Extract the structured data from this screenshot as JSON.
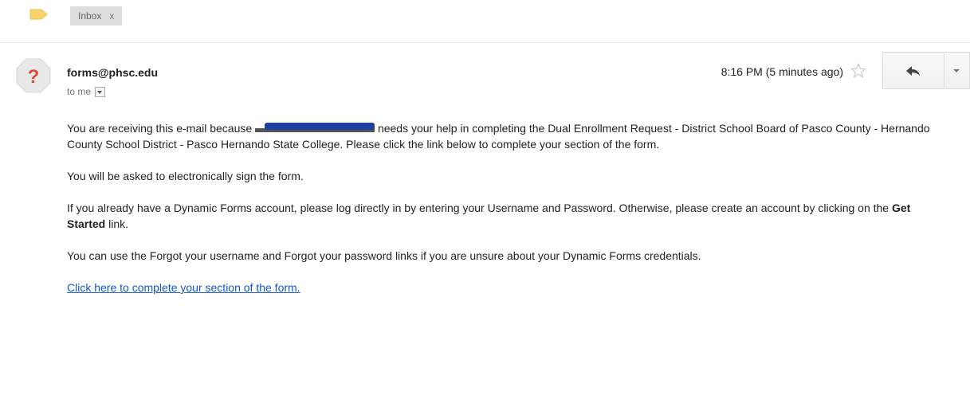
{
  "label_bar": {
    "icon": "label-tag-icon",
    "icon_color": "#f7d46b",
    "chip_label": "Inbox",
    "chip_close": "x"
  },
  "message": {
    "avatar_icon": "unknown-sender-icon",
    "avatar_color": "#dd4b39",
    "sender": "forms@phsc.edu",
    "recipient": "to me",
    "timestamp": "8:16 PM (5 minutes ago)",
    "star_icon": "star-icon",
    "reply_icon": "reply-arrow-icon",
    "more_icon": "chevron-down-icon",
    "body": {
      "p1_before": "You are receiving this e-mail because",
      "p1_after": "needs your help in completing the Dual Enrollment Request - District School Board of Pasco County - Hernando County School District - Pasco Hernando State College. Please click the link below to complete your section of the form.",
      "p2": "You will be asked to electronically sign the form.",
      "p3_before": "If you already have a Dynamic Forms account, please log directly in by entering your Username and Password. Otherwise, please create an account by clicking on the",
      "p3_bold": "Get Started",
      "p3_after": "link.",
      "p4": "You can use the Forgot your username and Forgot your password links if you are unsure about your Dynamic Forms credentials.",
      "link": "Click here to complete your section of the form."
    }
  }
}
